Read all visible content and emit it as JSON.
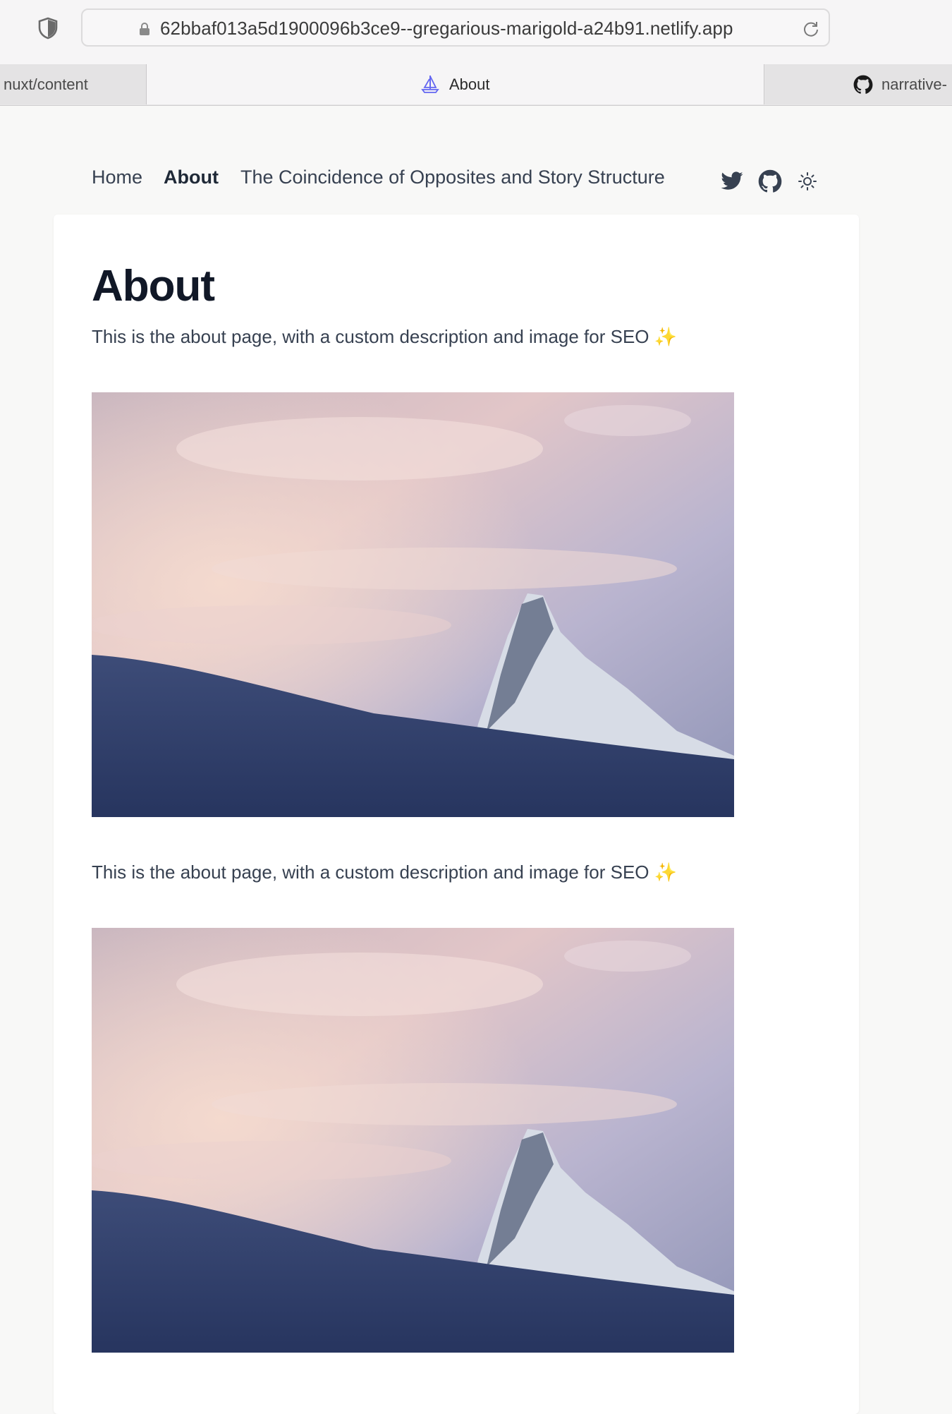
{
  "browser": {
    "url": "62bbaf013a5d1900096b3ce9--gregarious-marigold-a24b91.netlify.app",
    "tabs": [
      {
        "label": "nuxt/content",
        "icon": "none"
      },
      {
        "label": "About",
        "icon": "sailboat-icon",
        "active": true
      },
      {
        "label": "narrative-",
        "icon": "github-icon"
      }
    ]
  },
  "nav": {
    "links": [
      "Home",
      "About",
      "The Coincidence of Opposites and Story Structure"
    ],
    "icons": [
      "twitter-icon",
      "github-icon",
      "sun-icon"
    ]
  },
  "page": {
    "title": "About",
    "description": "This is the about page, with a custom description and image for SEO ✨",
    "body_text": "This is the about page, with a custom description and image for SEO ✨",
    "image_alt": "mountain-peak-at-sunset"
  },
  "colors": {
    "title": "#111827",
    "text": "#374151",
    "background": "#f8f8f7"
  }
}
